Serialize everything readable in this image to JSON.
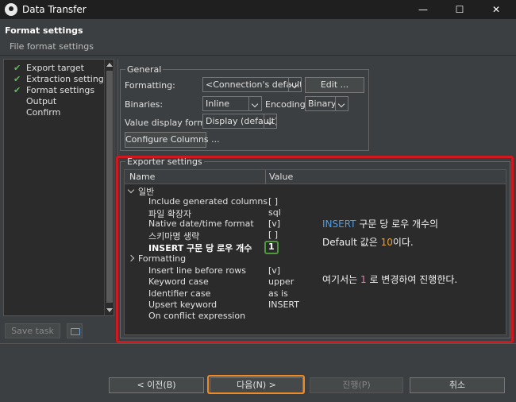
{
  "window": {
    "title": "Data Transfer",
    "controls": [
      "—",
      "☐",
      "✕"
    ]
  },
  "header": {
    "title": "Format settings",
    "subtitle": "File format settings"
  },
  "nav": {
    "items": [
      {
        "label": "Export target",
        "checked": true
      },
      {
        "label": "Extraction settings",
        "checked": true
      },
      {
        "label": "Format settings",
        "checked": true
      },
      {
        "label": "Output",
        "checked": false
      },
      {
        "label": "Confirm",
        "checked": false
      }
    ],
    "save_task_label": "Save task"
  },
  "general": {
    "title": "General",
    "formatting_label": "Formatting:",
    "formatting_value": "<Connection's default>",
    "edit_label": "Edit ...",
    "binaries_label": "Binaries:",
    "binaries_value": "Inline",
    "encoding_label": "Encoding:",
    "encoding_value": "Binary",
    "value_display_label": "Value display format:",
    "value_display_value": "Display (default)",
    "configure_columns_label": "Configure Columns ..."
  },
  "exporter": {
    "title": "Exporter settings",
    "col_name": "Name",
    "col_value": "Value",
    "groups": [
      {
        "label": "일반",
        "rows": [
          {
            "name": "Include generated columns",
            "value": "[ ]"
          },
          {
            "name": "파일 확장자",
            "value": "sql"
          },
          {
            "name": "Native date/time format",
            "value": "[v]"
          },
          {
            "name": "스키마명 생략",
            "value": "[ ]"
          },
          {
            "name": "INSERT 구문 당 로우 개수",
            "value": "1",
            "bold": true
          }
        ]
      },
      {
        "label": "Formatting",
        "rows": [
          {
            "name": "Insert line before rows",
            "value": "[v]"
          },
          {
            "name": "Keyword case",
            "value": "upper"
          },
          {
            "name": "Identifier case",
            "value": "as is"
          },
          {
            "name": "Upsert keyword",
            "value": "INSERT"
          },
          {
            "name": "On conflict expression",
            "value": ""
          }
        ]
      }
    ]
  },
  "annotation": {
    "line1_a": "INSERT",
    "line1_b": " 구문 당 로우 개수의",
    "line2_a": "Default 값은 ",
    "line2_b": "10",
    "line2_c": "이다.",
    "line3_a": "여기서는 ",
    "line3_b": "1",
    "line3_c": " 로 변경하여 진행한다."
  },
  "footer": {
    "back_label": "< 이전(B)",
    "next_label": "다음(N) >",
    "proceed_label": "진행(P)",
    "cancel_label": "취소"
  },
  "colors": {
    "highlight_red": "#d0181e",
    "highlight_green": "#4d9a3a",
    "highlight_orange": "#f08a24",
    "annot_blue": "#4a9ee8"
  }
}
